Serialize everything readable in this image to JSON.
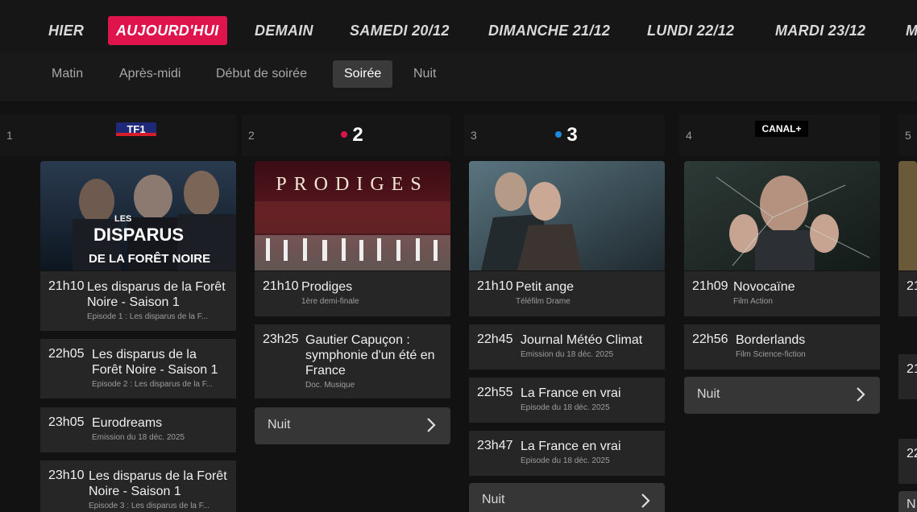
{
  "days": [
    "HIER",
    "AUJOURD'HUI",
    "DEMAIN",
    "SAMEDI 20/12",
    "DIMANCHE 21/12",
    "LUNDI 22/12",
    "MARDI 23/12",
    "M"
  ],
  "slots": [
    "Matin",
    "Après-midi",
    "Début de soirée",
    "Soirée",
    "Nuit"
  ],
  "channels": [
    {
      "num": "1",
      "logo": "TF1"
    },
    {
      "num": "2",
      "logo": "2"
    },
    {
      "num": "3",
      "logo": "3"
    },
    {
      "num": "4",
      "logo": "CANAL+"
    },
    {
      "num": "5"
    }
  ],
  "thumbs": {
    "tf1": {
      "line1": "LES",
      "line2": "DISPARUS",
      "line3": "DE LA FORÊT NOIRE"
    },
    "fr2": {
      "title": "PRODIGES"
    }
  },
  "col1": [
    {
      "time": "21h10",
      "title": "Les disparus de la Forêt Noire - Saison 1",
      "sub": "Episode 1 : Les disparus de la F..."
    },
    {
      "time": "22h05",
      "title": "Les disparus de la Forêt Noire - Saison 1",
      "sub": "Episode 2 : Les disparus de la F..."
    },
    {
      "time": "23h05",
      "title": "Eurodreams",
      "sub": "Emission du 18 déc. 2025"
    },
    {
      "time": "23h10",
      "title": "Les disparus de la Forêt Noire - Saison 1",
      "sub": "Episode 3 : Les disparus de la F..."
    }
  ],
  "col2": [
    {
      "time": "21h10",
      "title": "Prodiges",
      "sub": "1ère demi-finale"
    },
    {
      "time": "23h25",
      "title": "Gautier Capuçon : symphonie d'un été en France",
      "sub": "Doc. Musique"
    }
  ],
  "col3": [
    {
      "time": "21h10",
      "title": "Petit ange",
      "sub": "Téléfilm Drame"
    },
    {
      "time": "22h45",
      "title": "Journal Météo Climat",
      "sub": "Emission du 18 déc. 2025"
    },
    {
      "time": "22h55",
      "title": "La France en vrai",
      "sub": "Episode du 18 déc. 2025"
    },
    {
      "time": "23h47",
      "title": "La France en vrai",
      "sub": "Episode du 18 déc. 2025"
    }
  ],
  "col4": [
    {
      "time": "21h09",
      "title": "Novocaïne",
      "sub": "Film Action"
    },
    {
      "time": "22h56",
      "title": "Borderlands",
      "sub": "Film Science-fiction"
    }
  ],
  "col5_times": [
    "21",
    "21",
    "22",
    "N"
  ],
  "nuit_label": "Nuit",
  "colors": {
    "accent": "#e0144c",
    "card": "#262626",
    "background": "#121212"
  }
}
